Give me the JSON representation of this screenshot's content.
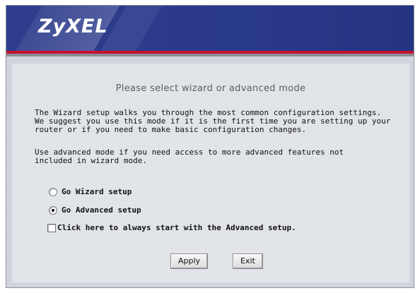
{
  "brand": {
    "logo": "ZyXEL"
  },
  "heading": "Please select wizard or advanced mode",
  "paragraphs": {
    "wizard": "The Wizard setup walks you through the most common configuration settings.\nWe suggest you use this mode if it is the first time you are setting up your\nrouter or if you need to make basic configuration changes.",
    "advanced": "Use advanced mode if you need access to more advanced features not\nincluded in wizard mode."
  },
  "options": [
    {
      "label": "Go Wizard setup",
      "selected": false
    },
    {
      "label": "Go Advanced setup",
      "selected": true
    }
  ],
  "always_advanced": {
    "label": "Click here to always start with the Advanced setup.",
    "checked": false
  },
  "buttons": {
    "apply": "Apply",
    "exit": "Exit"
  },
  "colors": {
    "banner": "#2a3a8a",
    "accent_bar": "#c8102e"
  }
}
